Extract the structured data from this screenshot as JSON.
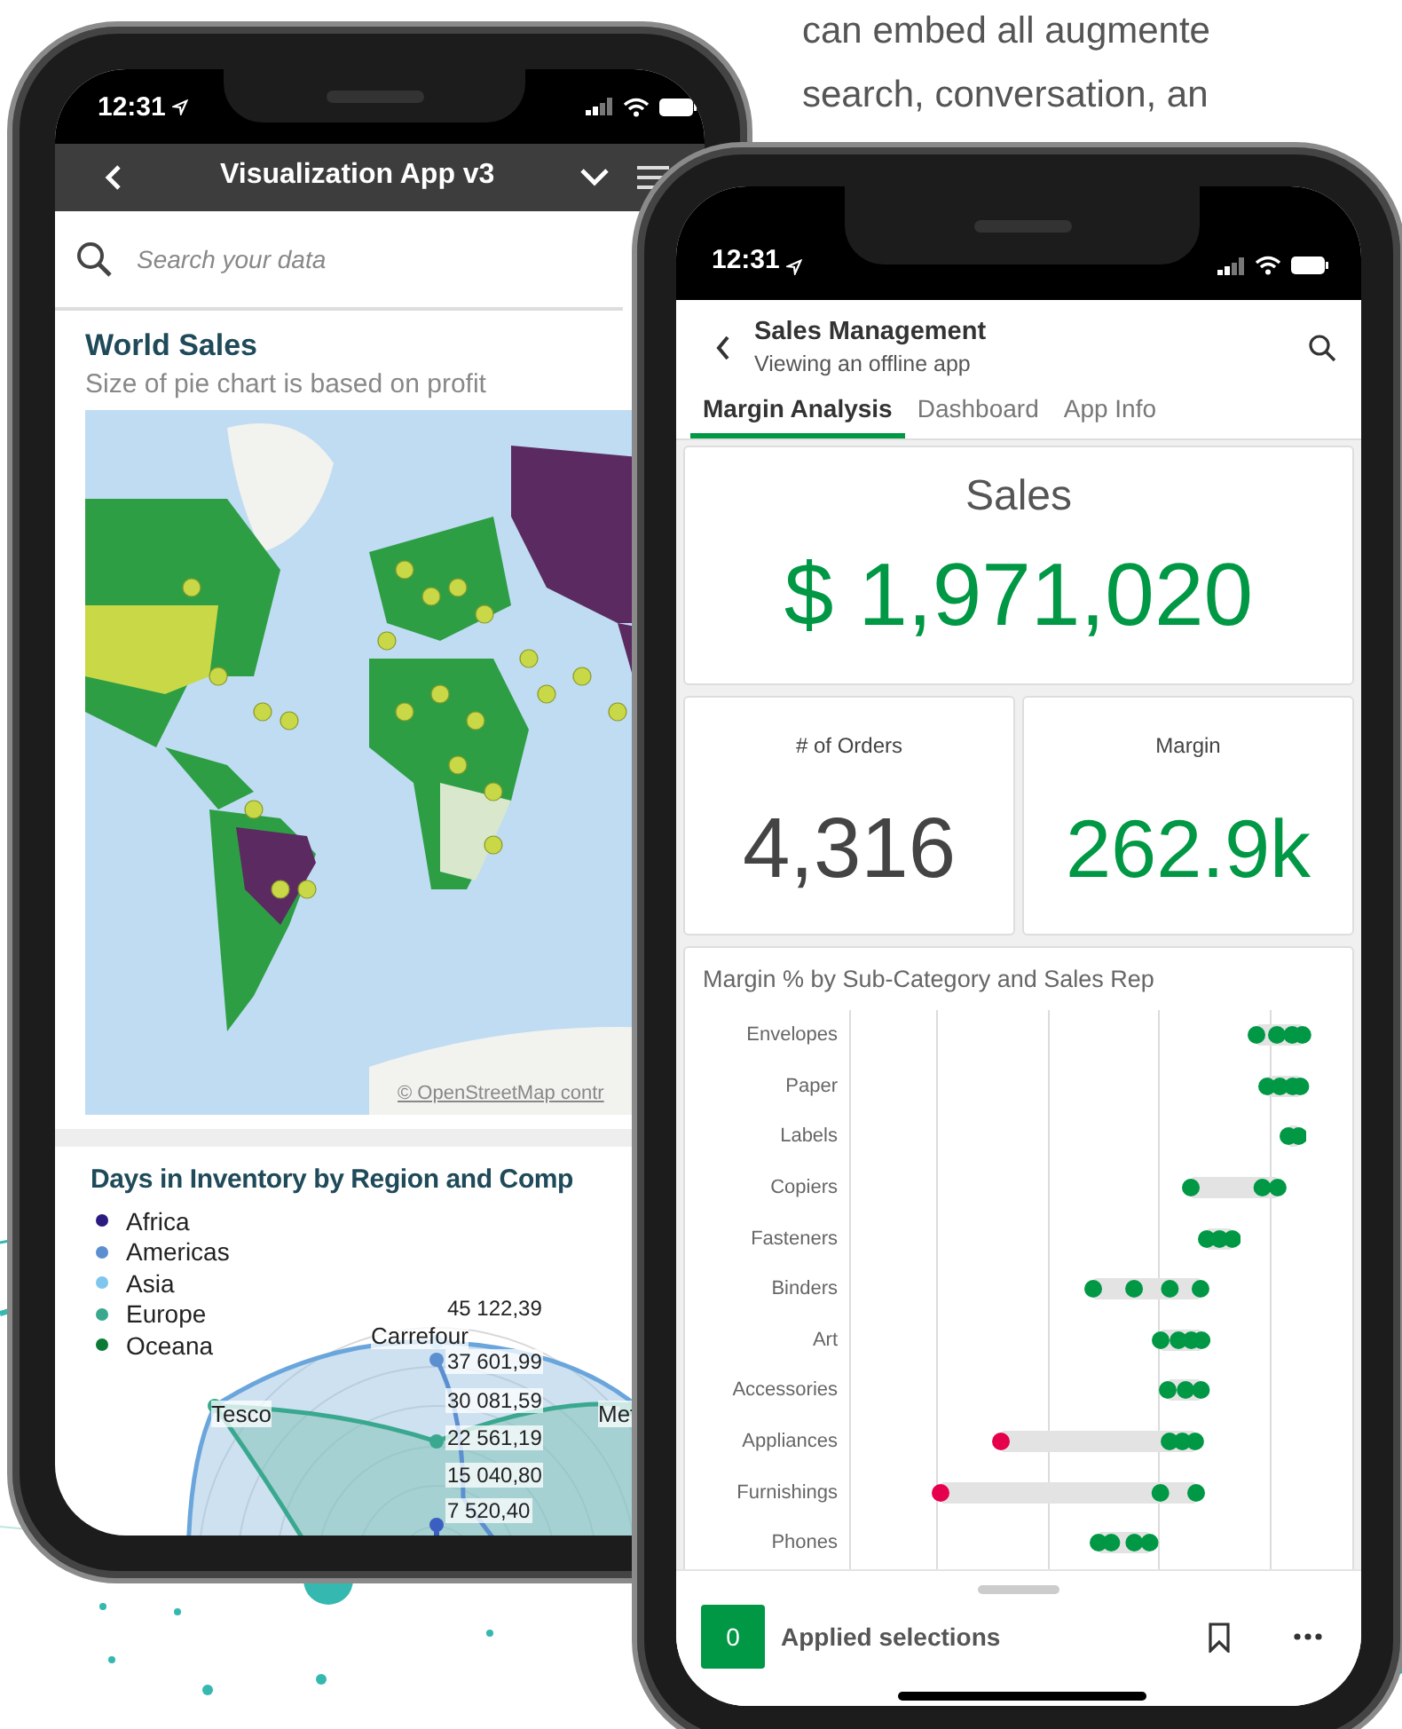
{
  "intro_text": [
    "can embed all augmente",
    "search, conversation, an"
  ],
  "phone_left": {
    "status_bar": {
      "time": "12:31"
    },
    "nav_bar": {
      "title": "Visualization App v3"
    },
    "search": {
      "placeholder": "Search your data"
    },
    "map_card": {
      "title": "World Sales",
      "subtitle": "Size of pie chart is based on profit",
      "attribution": "© OpenStreetMap contr"
    },
    "inventory_card": {
      "title": "Days in Inventory by Region and Comp",
      "legend": [
        {
          "label": "Africa",
          "color": "#2b1b80"
        },
        {
          "label": "Americas",
          "color": "#5b8fd0"
        },
        {
          "label": "Asia",
          "color": "#7fc6ef"
        },
        {
          "label": "Europe",
          "color": "#3aa88f"
        },
        {
          "label": "Oceana",
          "color": "#0b7a35"
        }
      ],
      "axis_labels": [
        "45 122,39",
        "37 601,99",
        "30 081,59",
        "22 561,19",
        "15 040,80",
        "7 520,40"
      ],
      "companies": [
        "Carrefour",
        "Tesco",
        "Met"
      ]
    }
  },
  "phone_right": {
    "status_bar": {
      "time": "12:31"
    },
    "header": {
      "title": "Sales Management",
      "subtitle": "Viewing an offline app"
    },
    "tabs": [
      {
        "label": "Margin Analysis",
        "selected": true
      },
      {
        "label": "Dashboard",
        "selected": false
      },
      {
        "label": "App Info",
        "selected": false
      }
    ],
    "sales_kpi": {
      "label": "Sales",
      "value": "$ 1,971,020",
      "kind": "positive"
    },
    "kpis": [
      {
        "label": "# of Orders",
        "value": "4,316",
        "kind": "neutral"
      },
      {
        "label": "Margin",
        "value": "262.9k",
        "kind": "positive"
      }
    ],
    "chart": {
      "title": "Margin % by Sub-Category and Sales Rep",
      "categories": [
        "Envelopes",
        "Paper",
        "Labels",
        "Copiers",
        "Fasteners",
        "Binders",
        "Art",
        "Accessories",
        "Appliances",
        "Furnishings",
        "Phones"
      ]
    },
    "footer": {
      "count": "0",
      "label": "Applied selections"
    }
  }
}
